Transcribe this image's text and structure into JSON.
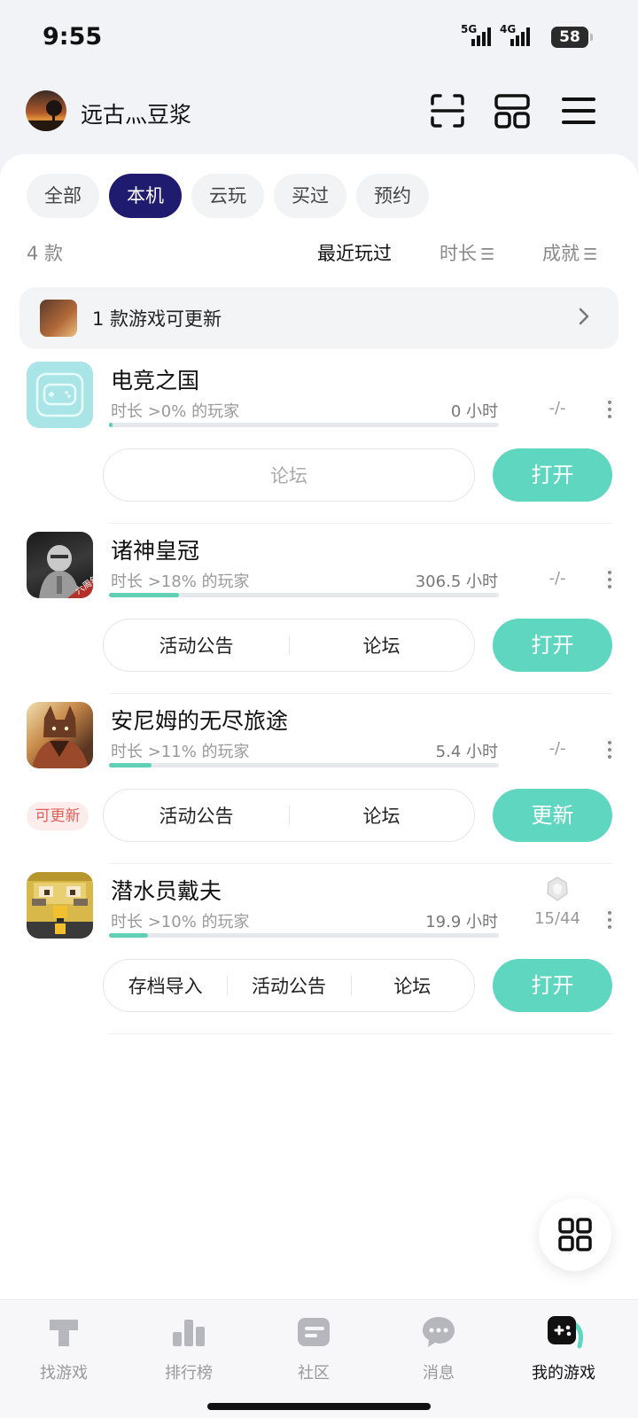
{
  "status_bar": {
    "time": "9:55",
    "net1": "5G",
    "net2": "4G",
    "battery": "58"
  },
  "header": {
    "username": "远古灬豆浆",
    "icons": [
      "scan-icon",
      "layout-icon",
      "menu-icon"
    ]
  },
  "filters": {
    "chips": [
      {
        "label": "全部",
        "active": false
      },
      {
        "label": "本机",
        "active": true
      },
      {
        "label": "云玩",
        "active": false
      },
      {
        "label": "买过",
        "active": false
      },
      {
        "label": "预约",
        "active": false
      }
    ]
  },
  "sort": {
    "count": "4 款",
    "recent": "最近玩过",
    "duration": "时长",
    "achievement": "成就"
  },
  "update_notice": {
    "text": "1 款游戏可更新"
  },
  "games": [
    {
      "name": "电竞之国",
      "percent_text": "时长 >0% 的玩家",
      "hours": "0 小时",
      "progress": 0.01,
      "achievement": "-/-",
      "actions": [
        "论坛"
      ],
      "primary": "打开",
      "badge": ""
    },
    {
      "name": "诸神皇冠",
      "percent_text": "时长 >18% 的玩家",
      "hours": "306.5 小时",
      "progress": 0.18,
      "achievement": "-/-",
      "actions": [
        "活动公告",
        "论坛"
      ],
      "primary": "打开",
      "badge": "",
      "icon_badge": "六周年"
    },
    {
      "name": "安尼姆的无尽旅途",
      "percent_text": "时长 >11% 的玩家",
      "hours": "5.4 小时",
      "progress": 0.11,
      "achievement": "-/-",
      "actions": [
        "活动公告",
        "论坛"
      ],
      "primary": "更新",
      "badge": "可更新"
    },
    {
      "name": "潜水员戴夫",
      "percent_text": "时长 >10% 的玩家",
      "hours": "19.9 小时",
      "progress": 0.1,
      "achievement": "15/44",
      "actions": [
        "存档导入",
        "活动公告",
        "论坛"
      ],
      "primary": "打开",
      "badge": ""
    }
  ],
  "bottom_nav": [
    {
      "label": "找游戏",
      "icon": "find-games-icon",
      "active": false
    },
    {
      "label": "排行榜",
      "icon": "ranking-icon",
      "active": false
    },
    {
      "label": "社区",
      "icon": "community-icon",
      "active": false
    },
    {
      "label": "消息",
      "icon": "message-icon",
      "active": false
    },
    {
      "label": "我的游戏",
      "icon": "my-games-icon",
      "active": true
    }
  ],
  "colors": {
    "accent": "#5fd6bf",
    "chip_active": "#1f1b6e",
    "update_badge": "#e0605a"
  }
}
